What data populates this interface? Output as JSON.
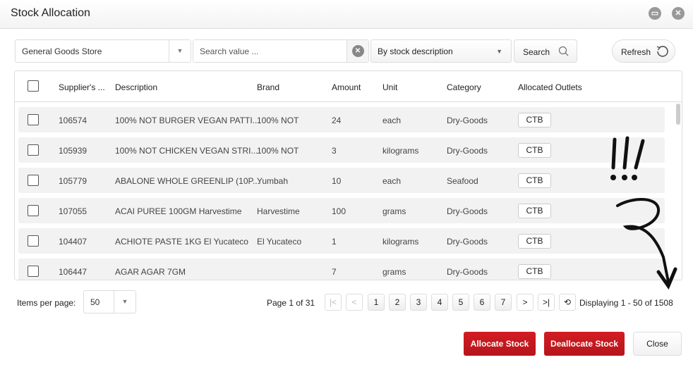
{
  "window": {
    "title": "Stock Allocation",
    "minimize_icon": "minimize-icon",
    "close_icon": "close-icon"
  },
  "toolbar": {
    "store": "General Goods Store",
    "search_placeholder": "Search value ...",
    "search_by": "By stock description",
    "search_label": "Search",
    "refresh_label": "Refresh"
  },
  "table": {
    "headers": [
      "Supplier's ...",
      "Description",
      "Brand",
      "Amount",
      "Unit",
      "Category",
      "Allocated Outlets"
    ],
    "rows": [
      [
        "106574",
        "100% NOT BURGER VEGAN PATTI...",
        "100% NOT",
        "24",
        "each",
        "Dry-Goods",
        "CTB"
      ],
      [
        "105939",
        "100% NOT CHICKEN VEGAN STRI...",
        "100% NOT",
        "3",
        "kilograms",
        "Dry-Goods",
        "CTB"
      ],
      [
        "105779",
        "ABALONE WHOLE GREENLIP (10P...",
        "Yumbah",
        "10",
        "each",
        "Seafood",
        "CTB"
      ],
      [
        "107055",
        "ACAI PUREE 100GM Harvestime",
        "Harvestime",
        "100",
        "grams",
        "Dry-Goods",
        "CTB"
      ],
      [
        "104407",
        "ACHIOTE PASTE 1KG El Yucateco",
        "El Yucateco",
        "1",
        "kilograms",
        "Dry-Goods",
        "CTB"
      ],
      [
        "106447",
        "AGAR AGAR 7GM",
        "",
        "7",
        "grams",
        "Dry-Goods",
        "CTB"
      ]
    ]
  },
  "pager": {
    "items_label": "Items per page:",
    "per_page": "50",
    "page_info": "Page 1 of 31",
    "pages": [
      "1",
      "2",
      "3",
      "4",
      "5",
      "6",
      "7"
    ],
    "display": "Displaying 1 - 50 of 1508"
  },
  "footer": {
    "allocate": "Allocate Stock",
    "deallocate": "Deallocate Stock",
    "close": "Close"
  },
  "colors": {
    "accent": "#c4181e"
  },
  "annotation": {
    "marks": "!!!"
  }
}
